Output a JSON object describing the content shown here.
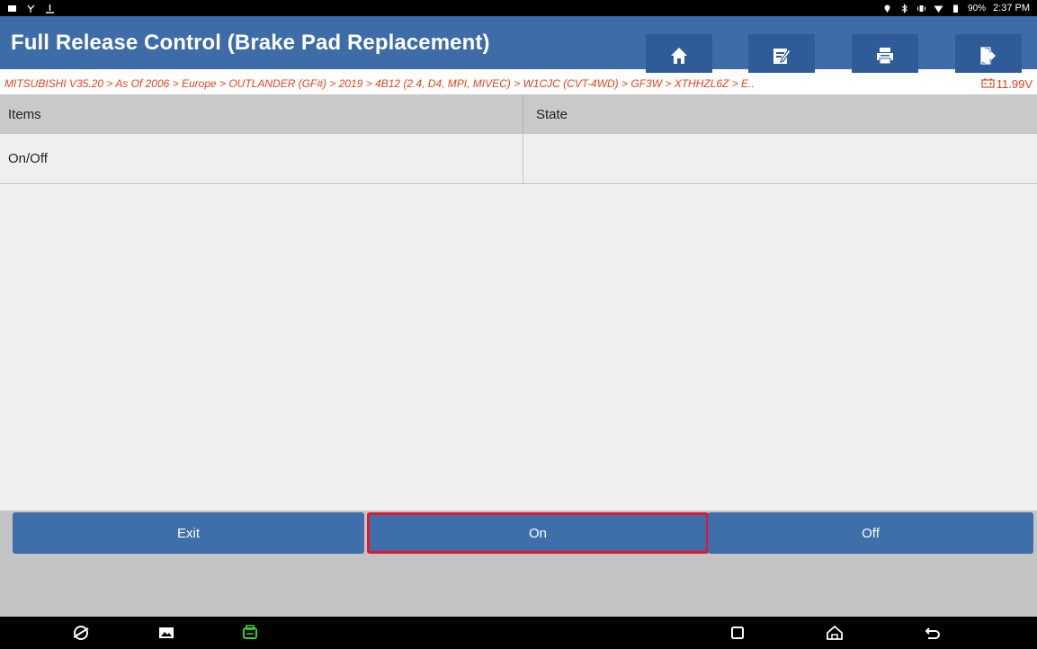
{
  "status_bar": {
    "battery": "90%",
    "time": "2:37 PM"
  },
  "header": {
    "title": "Full Release Control (Brake Pad Replacement)"
  },
  "breadcrumb": {
    "path": "MITSUBISHI V35.20 > As Of 2006 > Europe > OUTLANDER (GF#) > 2019 > 4B12 (2.4, D4, MPI, MIVEC) > W1CJC (CVT-4WD) > GF3W > XTHHZL6Z > E..",
    "voltage": "11.99V"
  },
  "table": {
    "columns": [
      "Items",
      "State"
    ],
    "rows": [
      {
        "item": "On/Off",
        "state": ""
      }
    ]
  },
  "actions": {
    "exit_label": "Exit",
    "on_label": "On",
    "off_label": "Off"
  },
  "colors": {
    "header_bg": "#3e6ca8",
    "button_bg": "#3f6faa",
    "highlight_border": "#e5152a",
    "breadcrumb_text": "#e8421c"
  }
}
